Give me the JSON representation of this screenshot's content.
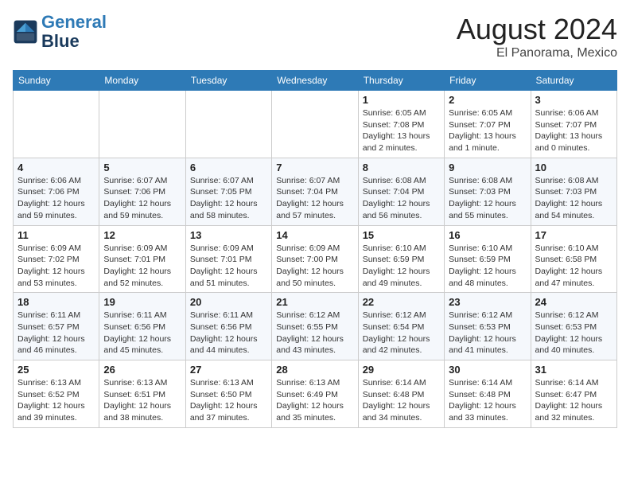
{
  "header": {
    "logo_line1": "General",
    "logo_line2": "Blue",
    "month": "August 2024",
    "location": "El Panorama, Mexico"
  },
  "days_of_week": [
    "Sunday",
    "Monday",
    "Tuesday",
    "Wednesday",
    "Thursday",
    "Friday",
    "Saturday"
  ],
  "weeks": [
    [
      {
        "day": "",
        "info": ""
      },
      {
        "day": "",
        "info": ""
      },
      {
        "day": "",
        "info": ""
      },
      {
        "day": "",
        "info": ""
      },
      {
        "day": "1",
        "info": "Sunrise: 6:05 AM\nSunset: 7:08 PM\nDaylight: 13 hours\nand 2 minutes."
      },
      {
        "day": "2",
        "info": "Sunrise: 6:05 AM\nSunset: 7:07 PM\nDaylight: 13 hours\nand 1 minute."
      },
      {
        "day": "3",
        "info": "Sunrise: 6:06 AM\nSunset: 7:07 PM\nDaylight: 13 hours\nand 0 minutes."
      }
    ],
    [
      {
        "day": "4",
        "info": "Sunrise: 6:06 AM\nSunset: 7:06 PM\nDaylight: 12 hours\nand 59 minutes."
      },
      {
        "day": "5",
        "info": "Sunrise: 6:07 AM\nSunset: 7:06 PM\nDaylight: 12 hours\nand 59 minutes."
      },
      {
        "day": "6",
        "info": "Sunrise: 6:07 AM\nSunset: 7:05 PM\nDaylight: 12 hours\nand 58 minutes."
      },
      {
        "day": "7",
        "info": "Sunrise: 6:07 AM\nSunset: 7:04 PM\nDaylight: 12 hours\nand 57 minutes."
      },
      {
        "day": "8",
        "info": "Sunrise: 6:08 AM\nSunset: 7:04 PM\nDaylight: 12 hours\nand 56 minutes."
      },
      {
        "day": "9",
        "info": "Sunrise: 6:08 AM\nSunset: 7:03 PM\nDaylight: 12 hours\nand 55 minutes."
      },
      {
        "day": "10",
        "info": "Sunrise: 6:08 AM\nSunset: 7:03 PM\nDaylight: 12 hours\nand 54 minutes."
      }
    ],
    [
      {
        "day": "11",
        "info": "Sunrise: 6:09 AM\nSunset: 7:02 PM\nDaylight: 12 hours\nand 53 minutes."
      },
      {
        "day": "12",
        "info": "Sunrise: 6:09 AM\nSunset: 7:01 PM\nDaylight: 12 hours\nand 52 minutes."
      },
      {
        "day": "13",
        "info": "Sunrise: 6:09 AM\nSunset: 7:01 PM\nDaylight: 12 hours\nand 51 minutes."
      },
      {
        "day": "14",
        "info": "Sunrise: 6:09 AM\nSunset: 7:00 PM\nDaylight: 12 hours\nand 50 minutes."
      },
      {
        "day": "15",
        "info": "Sunrise: 6:10 AM\nSunset: 6:59 PM\nDaylight: 12 hours\nand 49 minutes."
      },
      {
        "day": "16",
        "info": "Sunrise: 6:10 AM\nSunset: 6:59 PM\nDaylight: 12 hours\nand 48 minutes."
      },
      {
        "day": "17",
        "info": "Sunrise: 6:10 AM\nSunset: 6:58 PM\nDaylight: 12 hours\nand 47 minutes."
      }
    ],
    [
      {
        "day": "18",
        "info": "Sunrise: 6:11 AM\nSunset: 6:57 PM\nDaylight: 12 hours\nand 46 minutes."
      },
      {
        "day": "19",
        "info": "Sunrise: 6:11 AM\nSunset: 6:56 PM\nDaylight: 12 hours\nand 45 minutes."
      },
      {
        "day": "20",
        "info": "Sunrise: 6:11 AM\nSunset: 6:56 PM\nDaylight: 12 hours\nand 44 minutes."
      },
      {
        "day": "21",
        "info": "Sunrise: 6:12 AM\nSunset: 6:55 PM\nDaylight: 12 hours\nand 43 minutes."
      },
      {
        "day": "22",
        "info": "Sunrise: 6:12 AM\nSunset: 6:54 PM\nDaylight: 12 hours\nand 42 minutes."
      },
      {
        "day": "23",
        "info": "Sunrise: 6:12 AM\nSunset: 6:53 PM\nDaylight: 12 hours\nand 41 minutes."
      },
      {
        "day": "24",
        "info": "Sunrise: 6:12 AM\nSunset: 6:53 PM\nDaylight: 12 hours\nand 40 minutes."
      }
    ],
    [
      {
        "day": "25",
        "info": "Sunrise: 6:13 AM\nSunset: 6:52 PM\nDaylight: 12 hours\nand 39 minutes."
      },
      {
        "day": "26",
        "info": "Sunrise: 6:13 AM\nSunset: 6:51 PM\nDaylight: 12 hours\nand 38 minutes."
      },
      {
        "day": "27",
        "info": "Sunrise: 6:13 AM\nSunset: 6:50 PM\nDaylight: 12 hours\nand 37 minutes."
      },
      {
        "day": "28",
        "info": "Sunrise: 6:13 AM\nSunset: 6:49 PM\nDaylight: 12 hours\nand 35 minutes."
      },
      {
        "day": "29",
        "info": "Sunrise: 6:14 AM\nSunset: 6:48 PM\nDaylight: 12 hours\nand 34 minutes."
      },
      {
        "day": "30",
        "info": "Sunrise: 6:14 AM\nSunset: 6:48 PM\nDaylight: 12 hours\nand 33 minutes."
      },
      {
        "day": "31",
        "info": "Sunrise: 6:14 AM\nSunset: 6:47 PM\nDaylight: 12 hours\nand 32 minutes."
      }
    ]
  ]
}
